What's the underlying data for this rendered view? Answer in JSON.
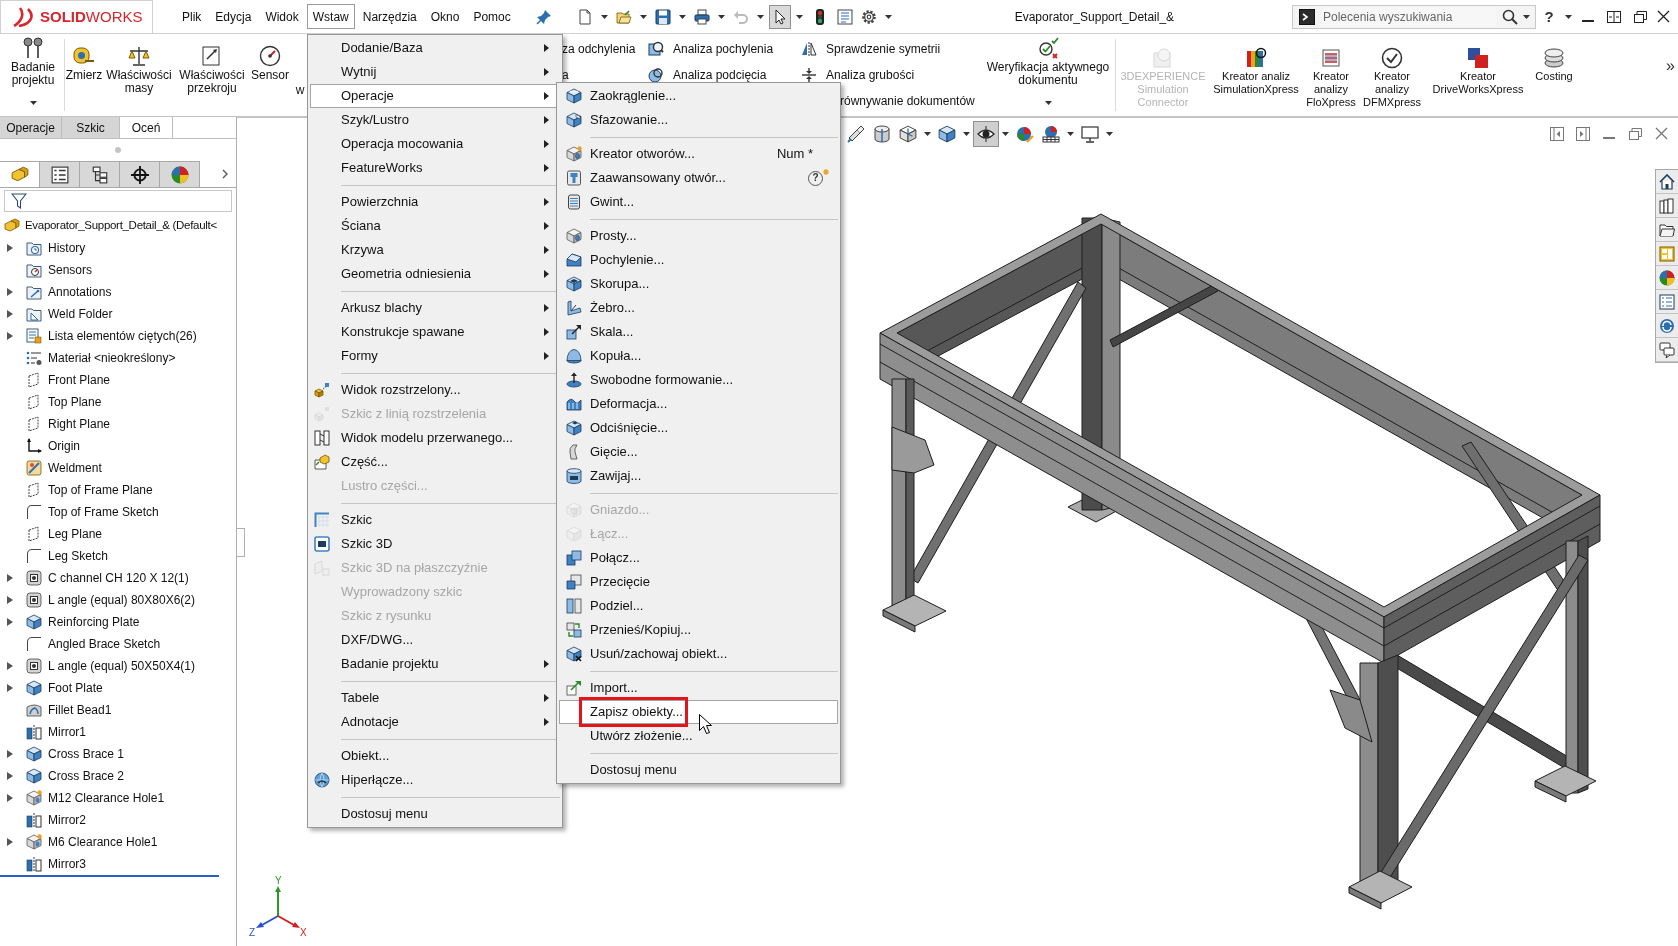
{
  "app": {
    "logo": "**SOLID**WORKS",
    "title": "Evaporator_Support_Detail_&",
    "help": "?"
  },
  "menubar": [
    {
      "label": "Plik",
      "selected": false
    },
    {
      "label": "Edycja",
      "selected": false
    },
    {
      "label": "Widok",
      "selected": false
    },
    {
      "label": "Wstaw",
      "selected": true
    },
    {
      "label": "Narzędzia",
      "selected": false
    },
    {
      "label": "Okno",
      "selected": false
    },
    {
      "label": "Pomoc",
      "selected": false
    }
  ],
  "quick_access": [
    {
      "dropdown": true,
      "pressed": false,
      "disabled": false
    },
    {
      "dropdown": true,
      "pressed": false,
      "disabled": false
    },
    {
      "dropdown": true,
      "pressed": false,
      "disabled": false
    },
    {
      "dropdown": true,
      "pressed": false,
      "disabled": false
    },
    {
      "dropdown": true,
      "pressed": false,
      "disabled": true
    },
    {
      "dropdown": true,
      "pressed": true,
      "disabled": false
    },
    {
      "dropdown": false,
      "pressed": false,
      "disabled": false
    },
    {
      "dropdown": false,
      "pressed": false,
      "disabled": false
    },
    {
      "dropdown": true,
      "pressed": false,
      "disabled": false
    }
  ],
  "search": {
    "placeholder": "Polecenia wyszukiwania"
  },
  "ribbon": {
    "left": [
      {
        "label": "Badanie\nprojektu",
        "dropdown": true
      },
      {
        "label": "Zmierz",
        "dropdown": false
      },
      {
        "label": "Właściwości\nmasy",
        "dropdown": false
      },
      {
        "label": "Właściwości\nprzekroju",
        "dropdown": false
      },
      {
        "label": "Sensor",
        "dropdown": false
      },
      {
        "label": "w",
        "dropdown": false
      }
    ],
    "columns": [
      [
        {
          "label": "za odchylenia"
        },
        {
          "label": "a"
        }
      ],
      [
        {
          "label": "Analiza pochylenia"
        },
        {
          "label": "Analiza podcięcia"
        }
      ],
      [
        {
          "label": "Sprawdzenie symetrii"
        },
        {
          "label": "Analiza grubości"
        },
        {
          "label": "równywanie dokumentów"
        }
      ]
    ],
    "verify": {
      "label": "Weryfikacja aktywnego\ndokumentu",
      "dropdown": true
    },
    "right": [
      {
        "label": "3DEXPERIENCE\nSimulation\nConnector",
        "disabled": true
      },
      {
        "label": "Kreator analiz\nSimulationXpress",
        "disabled": false
      },
      {
        "label": "Kreator\nanalizy\nFloXpress",
        "disabled": false
      },
      {
        "label": "Kreator\nanalizy\nDFMXpress",
        "disabled": false
      },
      {
        "label": "Kreator\nDriveWorksXpress",
        "disabled": false
      },
      {
        "label": "Costing",
        "disabled": false
      }
    ],
    "more": "»"
  },
  "command_tabs": [
    {
      "label": "Operacje",
      "selected": false
    },
    {
      "label": "Szkic",
      "selected": false
    },
    {
      "label": "Oceń",
      "selected": true
    }
  ],
  "panel_tabs": [
    {
      "selected": true
    },
    {
      "selected": false
    },
    {
      "selected": false
    },
    {
      "selected": false
    },
    {
      "selected": false
    }
  ],
  "tree": {
    "root": {
      "label": "Evaporator_Support_Detail_& (Default<",
      "kind": "part"
    },
    "items": [
      {
        "label": "History",
        "kind": "history",
        "expandable": true
      },
      {
        "label": "Sensors",
        "kind": "sensors",
        "expandable": false
      },
      {
        "label": "Annotations",
        "kind": "annotations",
        "expandable": true
      },
      {
        "label": "Weld Folder",
        "kind": "weldfolder",
        "expandable": true
      },
      {
        "label": "Lista elementów ciętych(26)",
        "kind": "cutlist",
        "expandable": true
      },
      {
        "label": "Materiał <nieokreślony>",
        "kind": "material",
        "expandable": false
      },
      {
        "label": "Front Plane",
        "kind": "plane",
        "expandable": false
      },
      {
        "label": "Top Plane",
        "kind": "plane",
        "expandable": false
      },
      {
        "label": "Right Plane",
        "kind": "plane",
        "expandable": false
      },
      {
        "label": "Origin",
        "kind": "origin",
        "expandable": false
      },
      {
        "label": "Weldment",
        "kind": "weldment",
        "expandable": false
      },
      {
        "label": "Top of Frame Plane",
        "kind": "plane",
        "expandable": false
      },
      {
        "label": "Top of Frame Sketch",
        "kind": "sketch",
        "expandable": false
      },
      {
        "label": "Leg Plane",
        "kind": "plane",
        "expandable": false
      },
      {
        "label": "Leg Sketch",
        "kind": "sketch",
        "expandable": false
      },
      {
        "label": "C channel CH 120 X 12(1)",
        "kind": "profile",
        "expandable": true
      },
      {
        "label": "L angle (equal) 80X80X6(2)",
        "kind": "profile",
        "expandable": true
      },
      {
        "label": "Reinforcing Plate",
        "kind": "body",
        "expandable": true
      },
      {
        "label": "Angled Brace Sketch",
        "kind": "sketch",
        "expandable": false
      },
      {
        "label": "L angle (equal) 50X50X4(1)",
        "kind": "profile",
        "expandable": true
      },
      {
        "label": "Foot Plate",
        "kind": "body",
        "expandable": true
      },
      {
        "label": "Fillet Bead1",
        "kind": "bead",
        "expandable": false
      },
      {
        "label": "Mirror1",
        "kind": "mirror",
        "expandable": false
      },
      {
        "label": "Cross Brace 1",
        "kind": "body",
        "expandable": true
      },
      {
        "label": "Cross Brace 2",
        "kind": "body",
        "expandable": true
      },
      {
        "label": "M12 Clearance Hole1",
        "kind": "hole",
        "expandable": true
      },
      {
        "label": "Mirror2",
        "kind": "mirror",
        "expandable": false
      },
      {
        "label": "M6 Clearance Hole1",
        "kind": "hole",
        "expandable": true
      },
      {
        "label": "Mirror3",
        "kind": "mirror",
        "expandable": false
      }
    ]
  },
  "view_toolbar": [
    {
      "dropdown": false,
      "pressed": false
    },
    {
      "dropdown": false,
      "pressed": false
    },
    {
      "dropdown": true,
      "pressed": false
    },
    {
      "dropdown": true,
      "pressed": false
    },
    {
      "dropdown": true,
      "pressed": true
    },
    {
      "dropdown": false,
      "pressed": false
    },
    {
      "dropdown": true,
      "pressed": false
    },
    {
      "dropdown": true,
      "pressed": false
    }
  ],
  "insert_menu": {
    "groups": [
      [
        {
          "label": "Dodanie/Baza",
          "submenu": true,
          "disabled": false,
          "selected": false
        },
        {
          "label": "Wytnij",
          "submenu": true,
          "disabled": false,
          "selected": false
        },
        {
          "label": "Operacje",
          "submenu": true,
          "disabled": false,
          "selected": true
        },
        {
          "label": "Szyk/Lustro",
          "submenu": true,
          "disabled": false,
          "selected": false
        },
        {
          "label": "Operacja mocowania",
          "submenu": true,
          "disabled": false,
          "selected": false
        },
        {
          "label": "FeatureWorks",
          "submenu": true,
          "disabled": false,
          "selected": false
        }
      ],
      [
        {
          "label": "Powierzchnia",
          "submenu": true,
          "disabled": false,
          "selected": false
        },
        {
          "label": "Ściana",
          "submenu": true,
          "disabled": false,
          "selected": false
        },
        {
          "label": "Krzywa",
          "submenu": true,
          "disabled": false,
          "selected": false
        },
        {
          "label": "Geometria odniesienia",
          "submenu": true,
          "disabled": false,
          "selected": false
        }
      ],
      [
        {
          "label": "Arkusz blachy",
          "submenu": true,
          "disabled": false,
          "selected": false
        },
        {
          "label": "Konstrukcje spawane",
          "submenu": true,
          "disabled": false,
          "selected": false
        },
        {
          "label": "Formy",
          "submenu": true,
          "disabled": false,
          "selected": false
        }
      ],
      [
        {
          "label": "Widok rozstrzelony...",
          "submenu": false,
          "disabled": false,
          "selected": false
        },
        {
          "label": "Szkic z linią rozstrzelenia",
          "submenu": false,
          "disabled": true,
          "selected": false
        },
        {
          "label": "Widok modelu przerwanego...",
          "submenu": false,
          "disabled": false,
          "selected": false
        },
        {
          "label": "Część...",
          "submenu": false,
          "disabled": false,
          "selected": false
        },
        {
          "label": "Lustro części...",
          "submenu": false,
          "disabled": true,
          "selected": false
        }
      ],
      [
        {
          "label": "Szkic",
          "submenu": false,
          "disabled": false,
          "selected": false
        },
        {
          "label": "Szkic 3D",
          "submenu": false,
          "disabled": false,
          "selected": false
        },
        {
          "label": "Szkic 3D na płaszczyźnie",
          "submenu": false,
          "disabled": true,
          "selected": false
        },
        {
          "label": "Wyprowadzony szkic",
          "submenu": false,
          "disabled": true,
          "selected": false
        },
        {
          "label": "Szkic z rysunku",
          "submenu": false,
          "disabled": true,
          "selected": false
        },
        {
          "label": "DXF/DWG...",
          "submenu": false,
          "disabled": false,
          "selected": false
        },
        {
          "label": "Badanie projektu",
          "submenu": true,
          "disabled": false,
          "selected": false
        }
      ],
      [
        {
          "label": "Tabele",
          "submenu": true,
          "disabled": false,
          "selected": false
        },
        {
          "label": "Adnotacje",
          "submenu": true,
          "disabled": false,
          "selected": false
        }
      ],
      [
        {
          "label": "Obiekt...",
          "submenu": false,
          "disabled": false,
          "selected": false
        },
        {
          "label": "Hiperłącze...",
          "submenu": false,
          "disabled": false,
          "selected": false
        }
      ],
      [
        {
          "label": "Dostosuj menu",
          "submenu": false,
          "disabled": false,
          "selected": false
        }
      ]
    ]
  },
  "features_menu": {
    "groups": [
      [
        {
          "label": "Zaokrąglenie...",
          "disabled": false,
          "selected": false,
          "boxed": false
        },
        {
          "label": "Sfazowanie...",
          "disabled": false,
          "selected": false,
          "boxed": false
        }
      ],
      [
        {
          "label": "Kreator otworów...",
          "shortcut": "Num *",
          "disabled": false,
          "selected": false,
          "boxed": false
        },
        {
          "label": "Zaawansowany otwór...",
          "badge": "?",
          "disabled": false,
          "selected": false,
          "boxed": false
        },
        {
          "label": "Gwint...",
          "disabled": false,
          "selected": false,
          "boxed": false
        }
      ],
      [
        {
          "label": "Prosty...",
          "disabled": false,
          "selected": false,
          "boxed": false
        },
        {
          "label": "Pochylenie...",
          "disabled": false,
          "selected": false,
          "boxed": false
        },
        {
          "label": "Skorupa...",
          "disabled": false,
          "selected": false,
          "boxed": false
        },
        {
          "label": "Żebro...",
          "disabled": false,
          "selected": false,
          "boxed": false
        },
        {
          "label": "Skala...",
          "disabled": false,
          "selected": false,
          "boxed": false
        },
        {
          "label": "Kopuła...",
          "disabled": false,
          "selected": false,
          "boxed": false
        },
        {
          "label": "Swobodne formowanie...",
          "disabled": false,
          "selected": false,
          "boxed": false
        },
        {
          "label": "Deformacja...",
          "disabled": false,
          "selected": false,
          "boxed": false
        },
        {
          "label": "Odciśnięcie...",
          "disabled": false,
          "selected": false,
          "boxed": false
        },
        {
          "label": "Gięcie...",
          "disabled": false,
          "selected": false,
          "boxed": false
        },
        {
          "label": "Zawijaj...",
          "disabled": false,
          "selected": false,
          "boxed": false
        }
      ],
      [
        {
          "label": "Gniazdo...",
          "disabled": true,
          "selected": false,
          "boxed": false
        },
        {
          "label": "Łącz...",
          "disabled": true,
          "selected": false,
          "boxed": false
        },
        {
          "label": "Połącz...",
          "disabled": false,
          "selected": false,
          "boxed": false
        },
        {
          "label": "Przecięcie",
          "disabled": false,
          "selected": false,
          "boxed": false
        },
        {
          "label": "Podziel...",
          "disabled": false,
          "selected": false,
          "boxed": false
        },
        {
          "label": "Przenieś/Kopiuj...",
          "disabled": false,
          "selected": false,
          "boxed": false
        },
        {
          "label": "Usuń/zachowaj obiekt...",
          "disabled": false,
          "selected": false,
          "boxed": false
        }
      ],
      [
        {
          "label": "Import...",
          "disabled": false,
          "selected": false,
          "boxed": false
        },
        {
          "label": "Zapisz obiekty...",
          "disabled": false,
          "selected": true,
          "boxed": true
        },
        {
          "label": "Utwórz złożenie...",
          "disabled": false,
          "selected": false,
          "boxed": false
        }
      ],
      [
        {
          "label": "Dostosuj menu",
          "disabled": false,
          "selected": false,
          "boxed": false
        }
      ]
    ]
  },
  "triad": {
    "y": "Y",
    "z": "Z",
    "x": "X"
  }
}
